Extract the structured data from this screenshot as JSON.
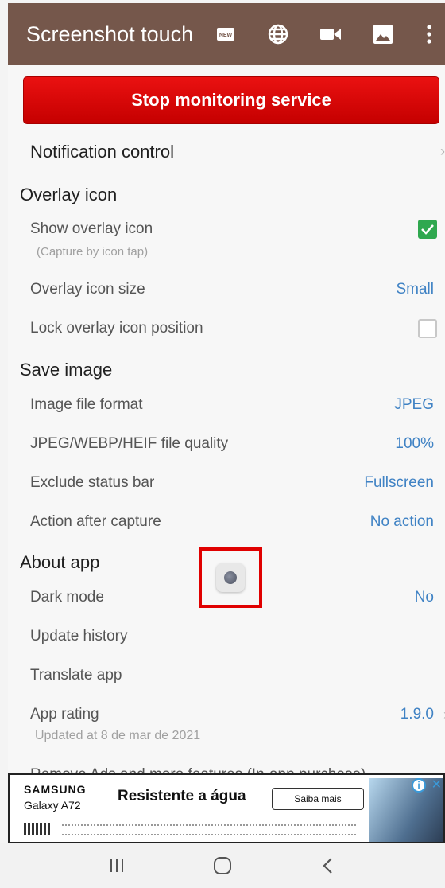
{
  "app": {
    "title": "Screenshot touch",
    "icons": [
      "new-icon",
      "globe-icon",
      "video-icon",
      "image-icon",
      "more-vert-icon"
    ],
    "colors": {
      "toolbar": "#75574b",
      "accent": "#3f82c4",
      "stop_button": "#e10d0d",
      "checkbox_on": "#2fa84f"
    }
  },
  "main": {
    "stop_button": "Stop monitoring service",
    "notification_control": "Notification control"
  },
  "overlay_section": {
    "title": "Overlay icon",
    "show_overlay_icon": {
      "label": "Show overlay icon",
      "sub": "(Capture by icon tap)",
      "checked": true
    },
    "overlay_icon_size": {
      "label": "Overlay icon size",
      "value": "Small"
    },
    "lock_position": {
      "label": "Lock overlay icon position",
      "checked": false
    }
  },
  "save_section": {
    "title": "Save image",
    "image_format": {
      "label": "Image file format",
      "value": "JPEG"
    },
    "quality": {
      "label": "JPEG/WEBP/HEIF file quality",
      "value": "100%"
    },
    "exclude_status_bar": {
      "label": "Exclude status bar",
      "value": "Fullscreen"
    },
    "action_after_capture": {
      "label": "Action after capture",
      "value": "No action"
    }
  },
  "about_section": {
    "title": "About app",
    "dark_mode": {
      "label": "Dark mode",
      "value": "No"
    },
    "update_history": {
      "label": "Update history"
    },
    "translate_app": {
      "label": "Translate app"
    },
    "app_rating": {
      "label": "App rating",
      "value": "1.9.0",
      "sub": "Updated at 8 de mar de 2021"
    },
    "remove_ads": {
      "label": "Remove Ads and more features (In-app purchase)"
    }
  },
  "ad": {
    "brand": "SAMSUNG",
    "model": "Galaxy A72",
    "headline": "Resistente a água",
    "cta": "Saiba mais"
  }
}
